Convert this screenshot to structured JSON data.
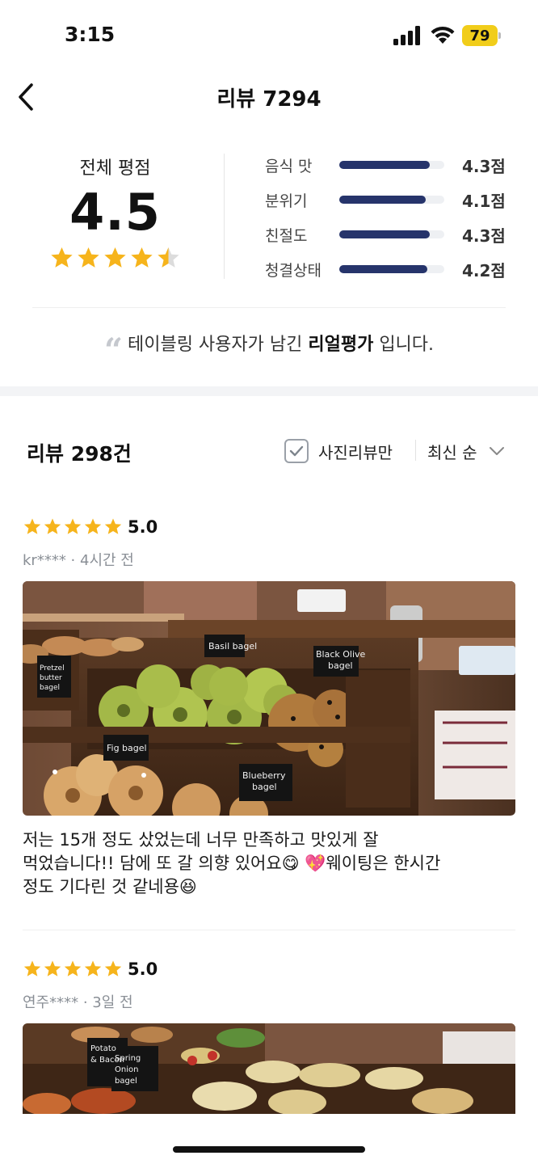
{
  "status_bar": {
    "time": "3:15",
    "battery": "79"
  },
  "header": {
    "title": "리뷰 7294"
  },
  "summary": {
    "overall_label": "전체 평점",
    "overall_score": "4.5",
    "overall_stars": 4.5,
    "metrics": [
      {
        "label": "음식 맛",
        "value": "4.3점",
        "fraction": 0.86
      },
      {
        "label": "분위기",
        "value": "4.1점",
        "fraction": 0.82
      },
      {
        "label": "친절도",
        "value": "4.3점",
        "fraction": 0.86
      },
      {
        "label": "청결상태",
        "value": "4.2점",
        "fraction": 0.84
      }
    ]
  },
  "notice": {
    "prefix": "테이블링 사용자가 남긴 ",
    "emphasis": "리얼평가",
    "suffix": " 입니다."
  },
  "reviews_header": {
    "count_label": "리뷰 298건",
    "photo_only_label": "사진리뷰만",
    "photo_only_checked": true,
    "sort_label": "최신 순"
  },
  "reviews": [
    {
      "stars": 5,
      "score": "5.0",
      "meta": "kr**** · 4시간 전",
      "text_line1": "저는 15개 정도 샀었는데 너무 만족하고 맛있게 잘",
      "text_line2": "먹었습니다!! 담에 또 갈 의향 있어요😋 💖웨이팅은 한시간",
      "text_line3": "정도 기다린 것 같네용😆",
      "photo_labels": [
        "Basil bagel",
        "Black Olive bagel",
        "Fig bagel",
        "Blueberry bagel",
        "Pretzel butter bagel"
      ]
    },
    {
      "stars": 5,
      "score": "5.0",
      "meta": "연주**** · 3일 전",
      "photo_labels": [
        "Potato & Bacon",
        "Spring Onion bagel"
      ]
    }
  ],
  "colors": {
    "star": "#f6b41c",
    "star_empty": "#dcdcdc",
    "bar_fill": "#26346b",
    "bar_track": "#eef0f3",
    "battery": "#f1cd1a"
  }
}
